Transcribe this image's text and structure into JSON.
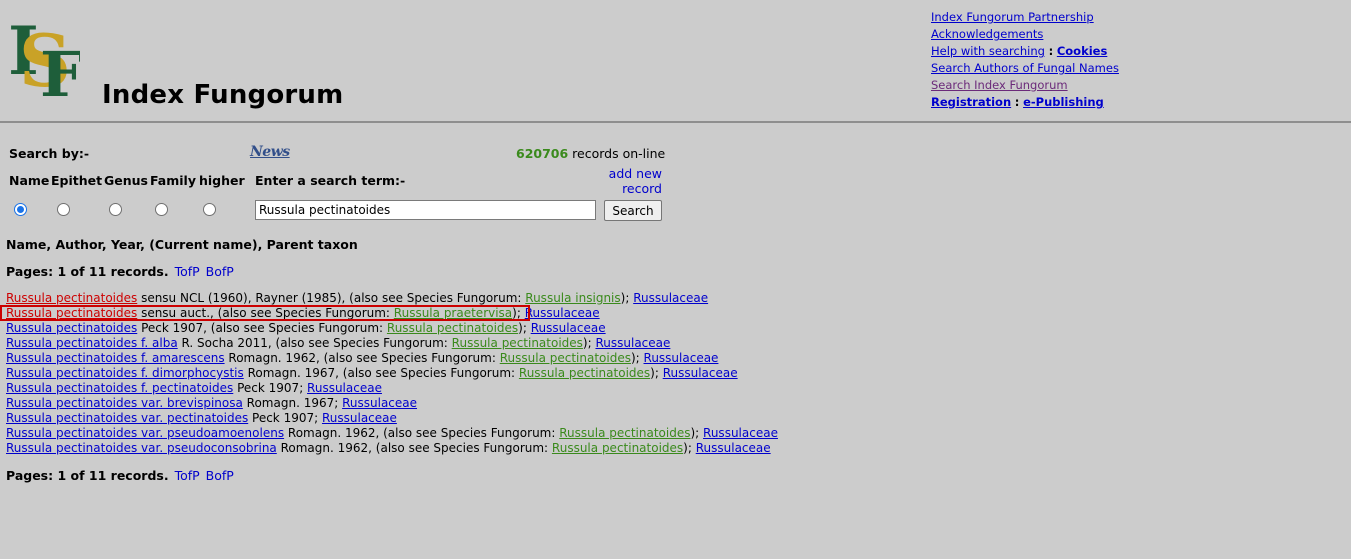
{
  "header": {
    "logo_letters": "ISF",
    "site_title": "Index Fungorum",
    "links": [
      {
        "label": "Index Fungorum Partnership"
      },
      {
        "label": "Acknowledgements"
      },
      {
        "label": "Help with searching",
        "sep": ":",
        "extra": "Cookies"
      },
      {
        "label": "Search Authors of Fungal Names"
      },
      {
        "label": "Search Index Fungorum"
      },
      {
        "label": "Registration",
        "sep": ":",
        "extra": "e-Publishing"
      }
    ]
  },
  "search": {
    "search_by_label": "Search by:-",
    "news_label": "News",
    "record_count": "620706",
    "records_suffix": "records on-line",
    "columns": [
      "Name",
      "Epithet",
      "Genus",
      "Family",
      "higher"
    ],
    "selected_column": "Name",
    "enter_term_label": "Enter a search term:-",
    "add_new_line1": "add new",
    "add_new_line2": "record",
    "term_value": "Russula pectinatoides",
    "button_label": "Search"
  },
  "results": {
    "header": "Name, Author, Year, (Current name), Parent taxon",
    "pages_label": "Pages: 1 of 11 records.",
    "tofp": "TofP",
    "bofp": "BofP",
    "rows": [
      {
        "name": "Russula pectinatoides",
        "name_color": "red",
        "text": " sensu NCL (1960), Rayner (1985), (also see Species Fungorum: ",
        "current": "Russula insignis",
        "tail": "); ",
        "parent": "Russulaceae"
      },
      {
        "name": "Russula pectinatoides",
        "name_color": "red",
        "text": " sensu auct., (also see Species Fungorum: ",
        "current": "Russula praetervisa",
        "tail": "); ",
        "parent": "Russulaceae"
      },
      {
        "name": "Russula pectinatoides",
        "name_color": "blue",
        "text": " Peck 1907, (also see Species Fungorum: ",
        "current": "Russula pectinatoides",
        "tail": "); ",
        "parent": "Russulaceae"
      },
      {
        "name": "Russula pectinatoides f. alba",
        "name_color": "blue",
        "text": " R. Socha 2011, (also see Species Fungorum: ",
        "current": "Russula pectinatoides",
        "tail": "); ",
        "parent": "Russulaceae"
      },
      {
        "name": "Russula pectinatoides f. amarescens",
        "name_color": "blue",
        "text": " Romagn. 1962, (also see Species Fungorum: ",
        "current": "Russula pectinatoides",
        "tail": "); ",
        "parent": "Russulaceae"
      },
      {
        "name": "Russula pectinatoides f. dimorphocystis",
        "name_color": "blue",
        "text": " Romagn. 1967, (also see Species Fungorum: ",
        "current": "Russula pectinatoides",
        "tail": "); ",
        "parent": "Russulaceae"
      },
      {
        "name": "Russula pectinatoides f. pectinatoides",
        "name_color": "blue",
        "text": " Peck 1907; ",
        "current": "",
        "tail": "",
        "parent": "Russulaceae"
      },
      {
        "name": "Russula pectinatoides var. brevispinosa",
        "name_color": "blue",
        "text": " Romagn. 1967; ",
        "current": "",
        "tail": "",
        "parent": "Russulaceae"
      },
      {
        "name": "Russula pectinatoides var. pectinatoides",
        "name_color": "blue",
        "text": " Peck 1907; ",
        "current": "",
        "tail": "",
        "parent": "Russulaceae"
      },
      {
        "name": "Russula pectinatoides var. pseudoamoenolens",
        "name_color": "blue",
        "text": " Romagn. 1962, (also see Species Fungorum: ",
        "current": "Russula pectinatoides",
        "tail": "); ",
        "parent": "Russulaceae"
      },
      {
        "name": "Russula pectinatoides var. pseudoconsobrina",
        "name_color": "blue",
        "text": " Romagn. 1962, (also see Species Fungorum: ",
        "current": "Russula pectinatoides",
        "tail": "); ",
        "parent": "Russulaceae"
      }
    ]
  },
  "colors": {
    "background": "#cccccc",
    "link": "#0000cc",
    "current_name": "#3a8a1c",
    "highlight": "#cc0000",
    "logo_green": "#1e5e3a",
    "logo_gold": "#c9a227"
  }
}
